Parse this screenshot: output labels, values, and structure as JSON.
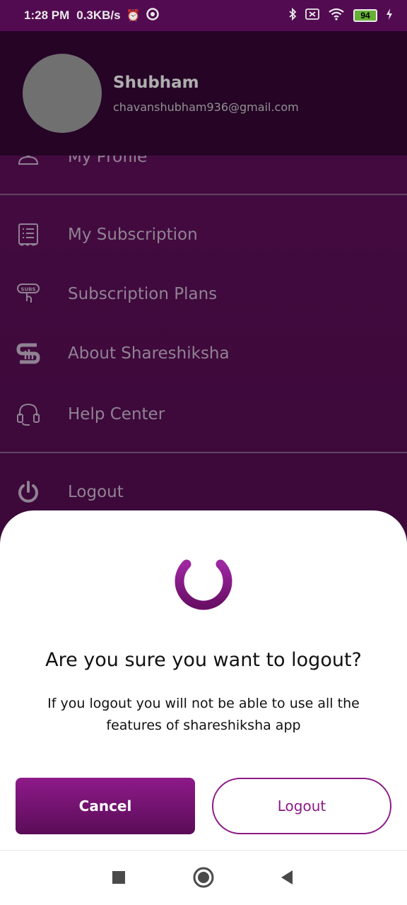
{
  "status_bar": {
    "time": "1:28 PM",
    "network_speed": "0.3KB/s",
    "battery": "94",
    "left_icons": [
      "alarm-icon",
      "sync-icon"
    ],
    "right_icons": [
      "bluetooth-icon",
      "sim-icon",
      "wifi-icon",
      "battery-icon",
      "charging-icon"
    ]
  },
  "drawer": {
    "user": {
      "name": "Shubham",
      "email": "chavanshubham936@gmail.com"
    },
    "items": [
      {
        "label": "My Profile",
        "icon": "profile-icon"
      },
      {
        "label": "My Subscription",
        "icon": "receipt-icon"
      },
      {
        "label": "Subscription Plans",
        "icon": "subs-icon"
      },
      {
        "label": "About Shareshiksha",
        "icon": "shareshiksha-logo-icon"
      },
      {
        "label": "Help Center",
        "icon": "headset-icon"
      },
      {
        "label": "Logout",
        "icon": "power-icon"
      }
    ]
  },
  "dialog": {
    "icon": "power-icon",
    "title": "Are you sure you want to logout?",
    "message": "If you logout you will not be able to use all the features of shareshiksha app",
    "cancel_label": "Cancel",
    "logout_label": "Logout"
  },
  "nav_bar": {
    "buttons": [
      "recents-icon",
      "home-icon",
      "back-icon"
    ]
  },
  "colors": {
    "status_bar": "#5a0d58",
    "drawer_bg": "#410a3e",
    "header_bg": "#29052a",
    "accent": "#8a1a86",
    "menu_text": "#9d8ea0"
  }
}
